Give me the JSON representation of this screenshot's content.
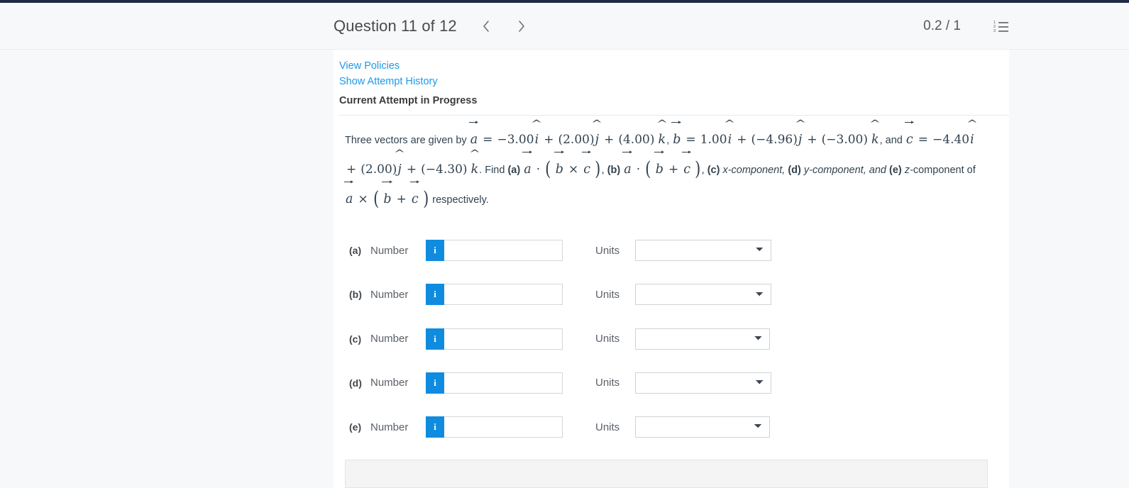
{
  "header": {
    "question_title": "Question 11 of 12",
    "prev_icon": "chevron-left-icon",
    "next_icon": "chevron-right-icon",
    "score": "0.2 / 1",
    "list_icon": "numbered-list-icon"
  },
  "links": {
    "view_policies": "View Policies",
    "show_attempt_history": "Show Attempt History",
    "current_attempt": "Current Attempt in Progress"
  },
  "problem": {
    "intro": "Three vectors are given by",
    "a_symbol": "a",
    "b_symbol": "b",
    "c_symbol": "c",
    "equals": "=",
    "a_components": {
      "i": "−3.00",
      "j": "(2.00)",
      "k": "(4.00)"
    },
    "b_components": {
      "i": "1.00",
      "j": "(−4.96)",
      "k": "(−3.00)"
    },
    "c_components": {
      "i": "−4.40",
      "j": "(2.00)",
      "k": "(−4.30)"
    },
    "i_hat": "i",
    "j_hat": "j",
    "k_hat": "k",
    "plus": "+",
    "and": ", and",
    "period_find": ". Find",
    "dot": "·",
    "cross": "×",
    "label_a": "(a)",
    "label_b": "(b)",
    "label_c": "(c)",
    "label_d": "(d)",
    "label_e": "(e)",
    "comma": ",",
    "x_component": "x-component,",
    "y_component": "y-component, and",
    "z_component": "z-",
    "component_of": "component of",
    "respectively": "respectively."
  },
  "answer_rows": [
    {
      "label": "(a)",
      "number_label": "Number",
      "info_icon": "info-icon",
      "info_glyph": "i",
      "value": "",
      "placeholder": "",
      "units_label": "Units",
      "units_value": "",
      "units_options": [
        ""
      ]
    },
    {
      "label": "(b)",
      "number_label": "Number",
      "info_icon": "info-icon",
      "info_glyph": "i",
      "value": "",
      "placeholder": "",
      "units_label": "Units",
      "units_value": "",
      "units_options": [
        ""
      ]
    },
    {
      "label": "(c)",
      "number_label": "Number",
      "info_icon": "info-icon",
      "info_glyph": "i",
      "value": "",
      "placeholder": "",
      "units_label": "Units",
      "units_value": "",
      "units_options": [
        ""
      ]
    },
    {
      "label": "(d)",
      "number_label": "Number",
      "info_icon": "info-icon",
      "info_glyph": "i",
      "value": "",
      "placeholder": "",
      "units_label": "Units",
      "units_value": "",
      "units_options": [
        ""
      ]
    },
    {
      "label": "(e)",
      "number_label": "Number",
      "info_icon": "info-icon",
      "info_glyph": "i",
      "value": "",
      "placeholder": "",
      "units_label": "Units",
      "units_value": "",
      "units_options": [
        ""
      ]
    }
  ],
  "colors": {
    "accent_blue": "#0f8ce0",
    "link_blue": "#1a99ec",
    "page_bg": "#f7f8f9",
    "card_bg": "#ffffff",
    "top_strip": "#1f2a44",
    "text_dark": "#32424f"
  }
}
